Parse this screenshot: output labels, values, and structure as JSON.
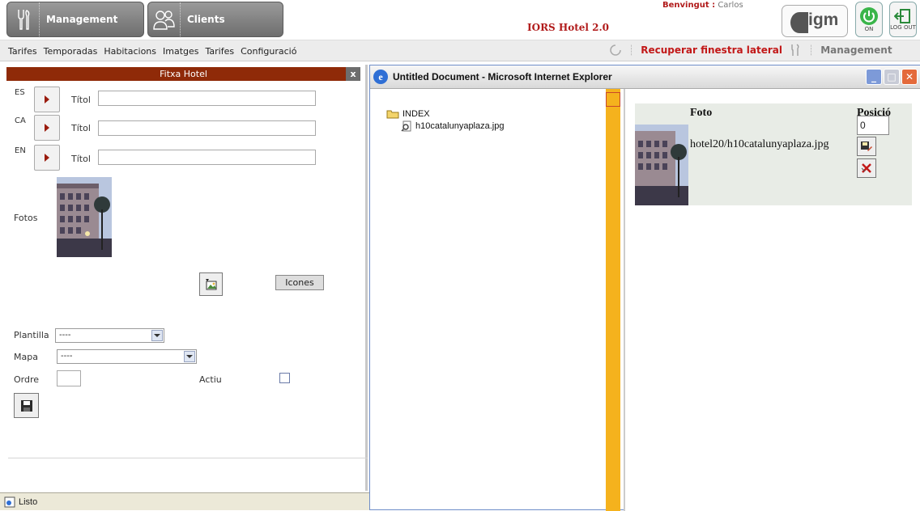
{
  "header": {
    "management_label": "Management",
    "clients_label": "Clients",
    "app_title": "IORS Hotel 2.0",
    "welcome_prefix": "Benvingut :",
    "welcome_user": "Carlos",
    "logo_text": "igm",
    "on_label": "ON",
    "logout_label": "LOG OUT"
  },
  "menu": {
    "items": [
      "Tarifes",
      "Temporadas",
      "Habitacions",
      "Imatges",
      "Tarifes",
      "Configuració"
    ],
    "recover_label": "Recuperar finestra lateral",
    "management_label": "Management"
  },
  "panel": {
    "title": "Fitxa Hotel",
    "close": "x",
    "languages": [
      {
        "code": "ES",
        "field_label": "Títol",
        "value": ""
      },
      {
        "code": "CA",
        "field_label": "Títol",
        "value": ""
      },
      {
        "code": "EN",
        "field_label": "Títol",
        "value": ""
      }
    ],
    "fotos_label": "Fotos",
    "icones_label": "Icones",
    "plantilla_label": "Plantilla",
    "plantilla_value": "----",
    "mapa_label": "Mapa",
    "mapa_value": "----",
    "ordre_label": "Ordre",
    "ordre_value": "",
    "actiu_label": "Actiu",
    "actiu_checked": false
  },
  "statusbar": {
    "text": "Listo"
  },
  "ie_window": {
    "title": "Untitled Document - Microsoft Internet Explorer",
    "tree": {
      "root": "INDEX",
      "file": "h10catalunyaplaza.jpg"
    },
    "gallery": {
      "col_foto": "Foto",
      "col_posicio": "Posició",
      "file_path": "hotel20/h10catalunyaplaza.jpg",
      "position_value": "0"
    }
  },
  "colors": {
    "brand_red": "#b11b1b",
    "panel_header": "#8f2a08",
    "ie_orange": "#f5b21d",
    "ie_titlebar_buttons": "#e46a3b"
  }
}
